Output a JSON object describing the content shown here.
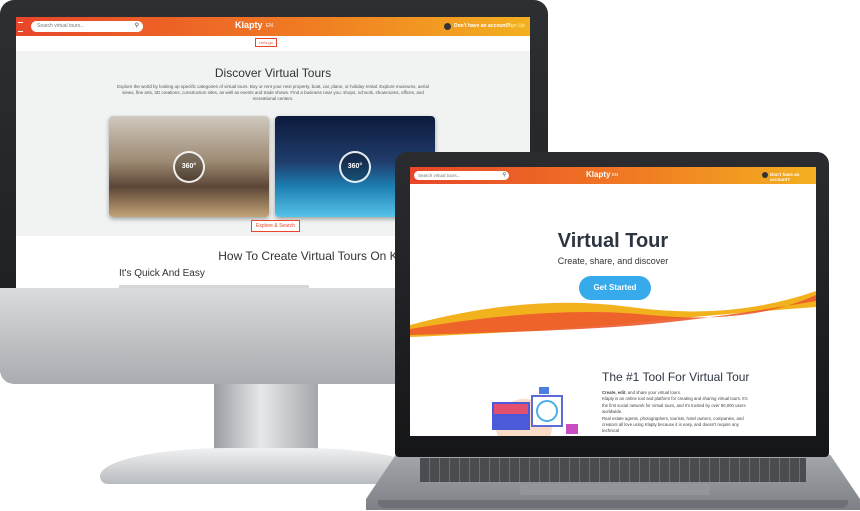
{
  "desktop": {
    "nav": {
      "search_placeholder": "Search virtual tours...",
      "logo": "Klapty",
      "language": "EN",
      "account_prompt": "Don't have an account?",
      "signup_label": "Sign Up"
    },
    "lets_go_label": "Let's go",
    "discover": {
      "title": "Discover Virtual Tours",
      "description": "Explore the world by looking up specific categories of virtual tours. Buy or rent your next property, boat, car, plane, or holiday rental. Explore museums, aerial views, fine arts, 3D creations, construction sites, as well as events and trade shows. Find a business near you: shops, schools, showrooms, offices, and recreational centers.",
      "tour_badge": "360°",
      "explore_button": "Explore & Search"
    },
    "howto": {
      "title": "How To Create Virtual Tours On Klapty?",
      "subtitle": "It's Quick And Easy"
    }
  },
  "laptop": {
    "nav": {
      "search_placeholder": "Search virtual tours...",
      "logo": "Klapty",
      "language": "EN",
      "account_prompt": "Don't have an account?"
    },
    "hero": {
      "title": "Virtual Tour",
      "subtitle": "Create, share, and discover",
      "cta_label": "Get Started"
    },
    "tool": {
      "title": "The #1 Tool For Virtual Tour",
      "lead_bold": "Create, edit",
      "lead_rest": ", and share your virtual tours.",
      "paragraph1": "Klapty is an online tool and platform for creating and sharing virtual tours. It's the first social network for virtual tours, and it's trusted by over 90,000 users worldwide.",
      "paragraph2": "Real estate agents, photographers, tourists, hotel owners, companies, and creators all love using Klapty because it is easy, and doesn't require any technical"
    }
  },
  "colors": {
    "brand_orange": "#e8462a",
    "brand_yellow": "#f3b020",
    "cta_blue": "#36aaea"
  }
}
